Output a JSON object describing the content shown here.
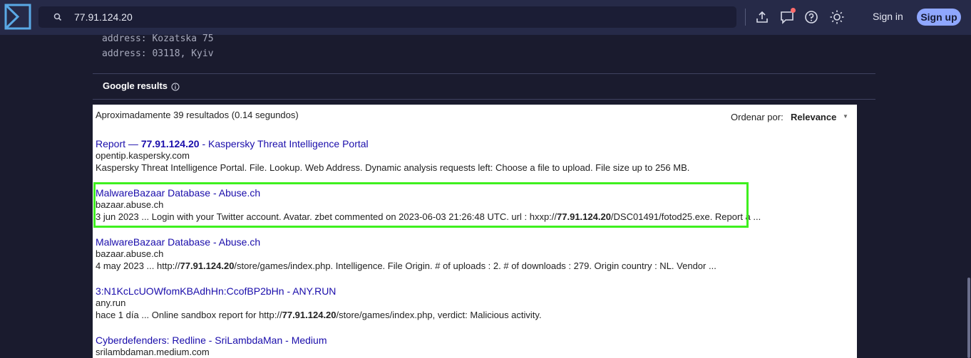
{
  "topbar": {
    "search_value": "77.91.124.20",
    "icons": [
      "upload-icon",
      "feedback-icon",
      "help-icon",
      "theme-icon"
    ],
    "sign_in": "Sign in",
    "sign_up": "Sign up",
    "colors": {
      "bar": "#262a48",
      "search_bg": "#1b1d35",
      "signup_bg": "#8fa7ff",
      "notif": "#ff6b6b"
    }
  },
  "whois": {
    "lines": [
      "address: Kozatska 75",
      "address: 03118, Kyiv"
    ]
  },
  "google": {
    "header": "Google results",
    "count": "Aproximadamente 39 resultados (0.14 segundos)",
    "sort_label": "Ordenar por:",
    "sort_value": "Relevance",
    "results": [
      {
        "title_pre": "Report — ",
        "title_bold": "77.91.124.20",
        "title_post": " - Kaspersky Threat Intelligence Portal",
        "url": "opentip.kaspersky.com",
        "snippet_pre": "Kaspersky Threat Intelligence Portal. File. Lookup. Web Address. Dynamic analysis requests left: Choose a file to upload. File size up to 256 MB.",
        "snippet_bold": "",
        "snippet_post": ""
      },
      {
        "title_pre": "MalwareBazaar Database - Abuse.ch",
        "title_bold": "",
        "title_post": "",
        "url": "bazaar.abuse.ch",
        "snippet_pre": "3 jun 2023 ... Login with your Twitter account. Avatar. zbet commented on 2023-06-03 21:26:48 UTC. url : hxxp://",
        "snippet_bold": "77.91.124.20",
        "snippet_post": "/DSC01491/fotod25.exe. Report a ..."
      },
      {
        "title_pre": "MalwareBazaar Database - Abuse.ch",
        "title_bold": "",
        "title_post": "",
        "url": "bazaar.abuse.ch",
        "snippet_pre": "4 may 2023 ... http://",
        "snippet_bold": "77.91.124.20",
        "snippet_post": "/store/games/index.php. Intelligence. File Origin. # of uploads : 2. # of downloads : 279. Origin country : NL. Vendor ..."
      },
      {
        "title_pre": "3:N1KcLcUOWfomKBAdhHn:CcofBP2bHn - ANY.RUN",
        "title_bold": "",
        "title_post": "",
        "url": "any.run",
        "snippet_pre": "hace 1 día ... Online sandbox report for http://",
        "snippet_bold": "77.91.124.20",
        "snippet_post": "/store/games/index.php, verdict: Malicious activity."
      },
      {
        "title_pre": "Cyberdefenders: Redline - SriLambdaMan - Medium",
        "title_bold": "",
        "title_post": "",
        "url": "srilambdaman.medium.com",
        "snippet_pre": "",
        "snippet_bold": "",
        "snippet_post": ""
      }
    ],
    "colors": {
      "link": "#1a0dab",
      "highlight": "#3ff01f"
    }
  }
}
